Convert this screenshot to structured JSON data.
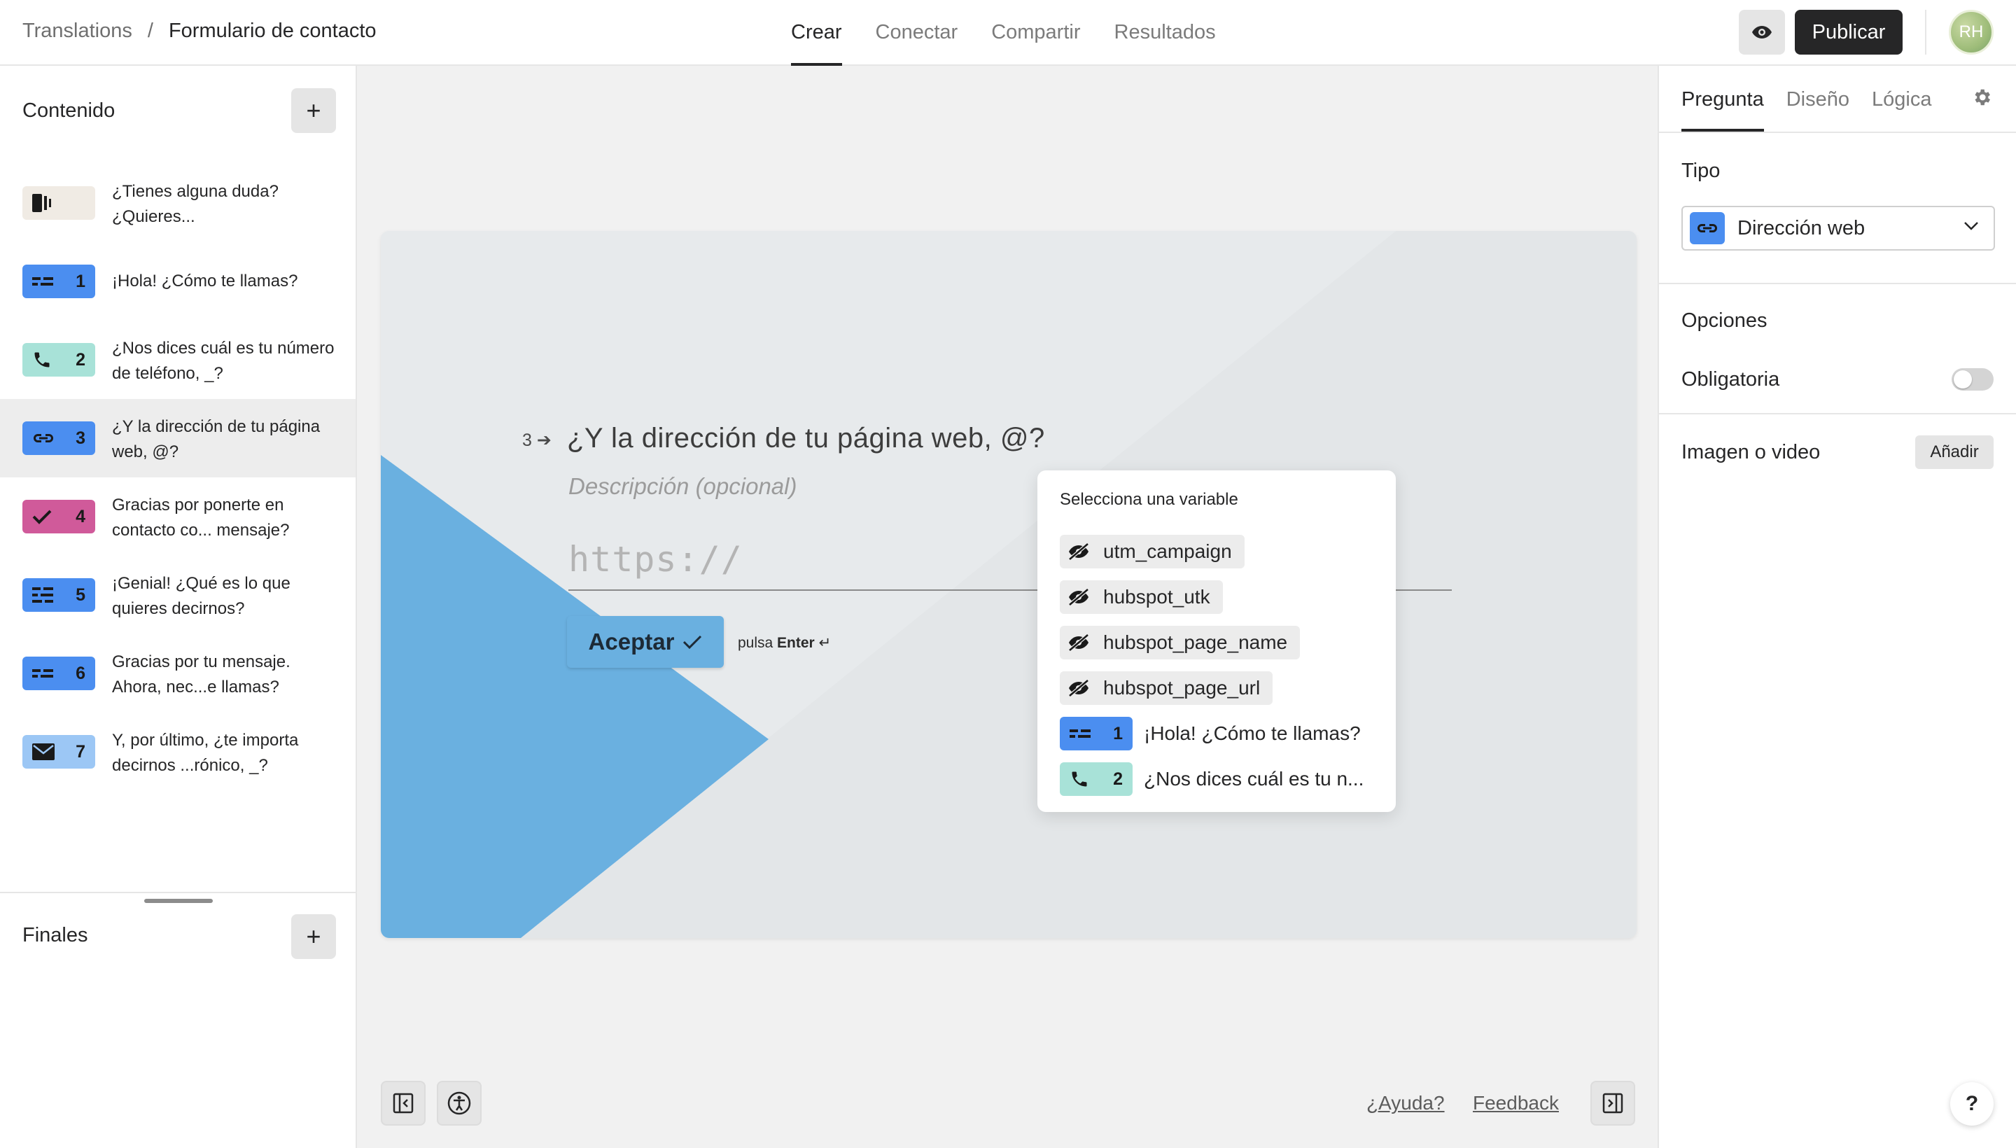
{
  "header": {
    "breadcrumb_root": "Translations",
    "breadcrumb_sep": "/",
    "breadcrumb_current": "Formulario de contacto",
    "tabs": [
      {
        "label": "Crear",
        "active": true
      },
      {
        "label": "Conectar",
        "active": false
      },
      {
        "label": "Compartir",
        "active": false
      },
      {
        "label": "Resultados",
        "active": false
      }
    ],
    "publish_label": "Publicar",
    "avatar_initials": "RH"
  },
  "sidebar": {
    "content_title": "Contenido",
    "add_symbol": "+",
    "items": [
      {
        "type": "welcome",
        "number": "",
        "text": "¿Tienes alguna duda? ¿Quieres...",
        "color": "#f0ebe4"
      },
      {
        "type": "short-text",
        "number": "1",
        "text": "¡Hola! ¿Cómo te llamas?",
        "color": "#4b8ef0"
      },
      {
        "type": "phone",
        "number": "2",
        "text": "¿Nos dices cuál es tu número de teléfono, _?",
        "color": "#a8e2d8"
      },
      {
        "type": "website",
        "number": "3",
        "text": "¿Y la dirección de tu página web, @?",
        "color": "#4b8ef0"
      },
      {
        "type": "statement",
        "number": "4",
        "text": "Gracias por ponerte en contacto co... mensaje?",
        "color": "#d05a9a"
      },
      {
        "type": "long-text",
        "number": "5",
        "text": "¡Genial! ¿Qué es lo que quieres decirnos?",
        "color": "#4b8ef0"
      },
      {
        "type": "short-text",
        "number": "6",
        "text": "Gracias por tu mensaje. Ahora, nec...e llamas?",
        "color": "#4b8ef0"
      },
      {
        "type": "email",
        "number": "7",
        "text": "Y, por último, ¿te importa decirnos ...rónico, _?",
        "color": "#9cc7f5"
      }
    ],
    "endings_title": "Finales"
  },
  "canvas": {
    "question_number": "3",
    "question_title": "¿Y la dirección de tu página web, @?",
    "description_placeholder": "Descripción (opcional)",
    "answer_placeholder": "https://",
    "accept_label": "Aceptar",
    "enter_hint_prefix": "pulsa",
    "enter_hint_key": "Enter",
    "enter_hint_symbol": "↵",
    "accent_color": "#6ab0e0"
  },
  "variable_popup": {
    "title": "Selecciona una variable",
    "hidden_fields": [
      "utm_campaign",
      "hubspot_utk",
      "hubspot_page_name",
      "hubspot_page_url"
    ],
    "questions": [
      {
        "number": "1",
        "text": "¡Hola! ¿Cómo te llamas?",
        "color": "#4b8ef0",
        "type": "short-text"
      },
      {
        "number": "2",
        "text": "¿Nos dices cuál es tu n...",
        "color": "#a8e2d8",
        "type": "phone"
      }
    ]
  },
  "footer": {
    "help_link": "¿Ayuda?",
    "feedback_link": "Feedback",
    "help_fab": "?"
  },
  "right_panel": {
    "tabs": [
      {
        "label": "Pregunta",
        "active": true
      },
      {
        "label": "Diseño",
        "active": false
      },
      {
        "label": "Lógica",
        "active": false
      }
    ],
    "type_label": "Tipo",
    "type_value": "Dirección web",
    "options_label": "Opciones",
    "required_label": "Obligatoria",
    "required_on": false,
    "media_label": "Imagen o video",
    "media_add": "Añadir"
  }
}
